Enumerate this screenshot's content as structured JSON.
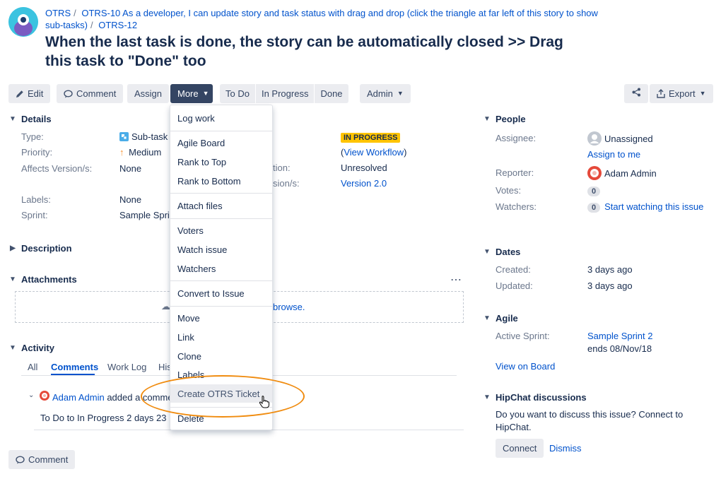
{
  "breadcrumbs": {
    "project": "OTRS",
    "parent": "OTRS-10 As a developer, I can update story and task status with drag and drop (click the triangle at far left of this story to show sub-tasks)",
    "key": "OTRS-12"
  },
  "issue": {
    "title": "When the last task is done, the story can be automatically closed >> Drag this task to \"Done\" too"
  },
  "toolbar": {
    "edit": "Edit",
    "comment": "Comment",
    "assign": "Assign",
    "more": "More",
    "todo": "To Do",
    "in_progress": "In Progress",
    "done": "Done",
    "admin": "Admin",
    "export": "Export"
  },
  "details": {
    "heading": "Details",
    "type_label": "Type:",
    "type_value": "Sub-task",
    "priority_label": "Priority:",
    "priority_value": "Medium",
    "affects_label": "Affects Version/s:",
    "affects_value": "None",
    "labels_label": "Labels:",
    "labels_value": "None",
    "sprint_label": "Sprint:",
    "sprint_value": "Sample Sprint",
    "status_value": "IN PROGRESS",
    "workflow_link": "View Workflow",
    "resolution_label_fragment": "tion:",
    "resolution_value": "Unresolved",
    "fix_label_fragment": "sion/s:",
    "fix_value": "Version 2.0"
  },
  "sections": {
    "description": "Description",
    "attachments": "Attachments",
    "attach_link_fragment": "browse.",
    "activity": "Activity",
    "people": "People",
    "dates": "Dates",
    "agile": "Agile",
    "hipchat": "HipChat discussions"
  },
  "activity": {
    "tabs": [
      "All",
      "Comments",
      "Work Log",
      "His"
    ],
    "author": "Adam Admin",
    "action_fragment": "added a comme",
    "entry_fragment": "To Do to In Progress 2 days 23 h",
    "comment_button": "Comment"
  },
  "people": {
    "assignee_label": "Assignee:",
    "assignee_value": "Unassigned",
    "assign_to_me": "Assign to me",
    "reporter_label": "Reporter:",
    "reporter_value": "Adam Admin",
    "votes_label": "Votes:",
    "votes_count": "0",
    "watchers_label": "Watchers:",
    "watchers_count": "0",
    "start_watching": "Start watching this issue"
  },
  "dates": {
    "created_label": "Created:",
    "created_value": "3 days ago",
    "updated_label": "Updated:",
    "updated_value": "3 days ago"
  },
  "agile": {
    "sprint_label": "Active Sprint:",
    "sprint_value": "Sample Sprint 2",
    "sprint_ends": "ends 08/Nov/18",
    "view_on_board": "View on Board"
  },
  "hipchat": {
    "prompt": "Do you want to discuss this issue? Connect to HipChat.",
    "connect": "Connect",
    "dismiss": "Dismiss"
  },
  "more_menu": {
    "items": [
      "Log work",
      "Agile Board",
      "Rank to Top",
      "Rank to Bottom",
      "Attach files",
      "Voters",
      "Watch issue",
      "Watchers",
      "Convert to Issue",
      "Move",
      "Link",
      "Clone",
      "Labels",
      "Create OTRS Ticket",
      "Delete"
    ]
  },
  "colors": {
    "primary": "#0052cc",
    "status_badge": "#ffc400",
    "highlight_oval": "#f08c10",
    "more_button": "#344563"
  }
}
